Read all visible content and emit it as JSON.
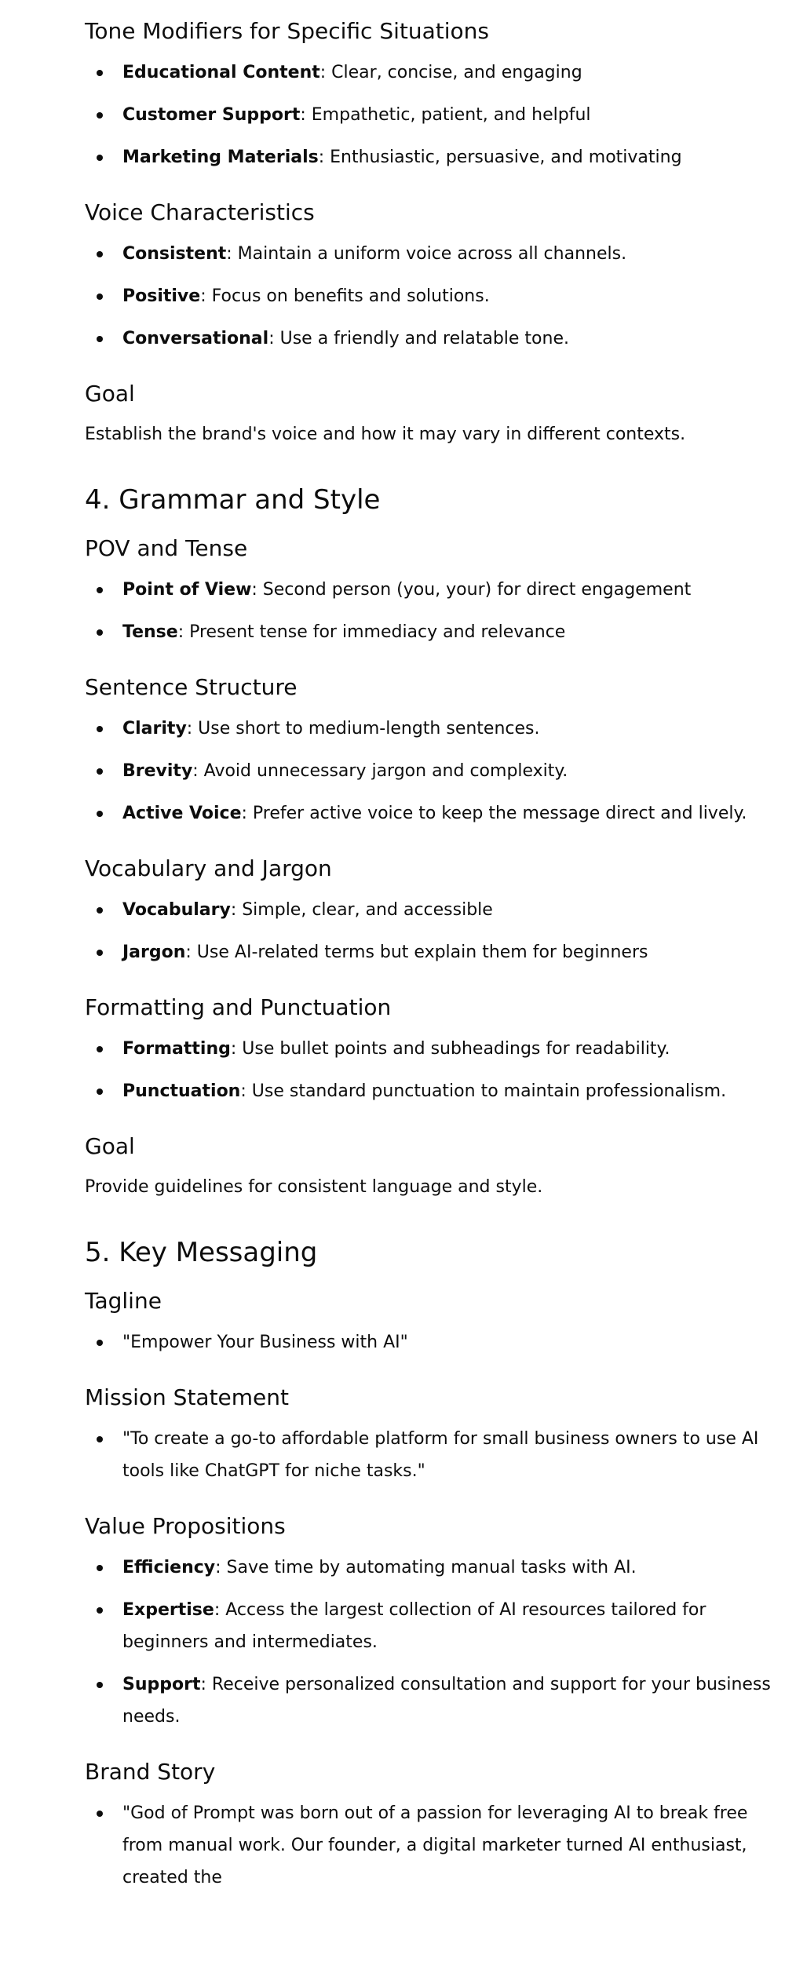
{
  "tone_modifiers": {
    "heading": "Tone Modifiers for Specific Situations",
    "items": [
      {
        "term": "Educational Content",
        "desc": ": Clear, concise, and engaging"
      },
      {
        "term": "Customer Support",
        "desc": ": Empathetic, patient, and helpful"
      },
      {
        "term": "Marketing Materials",
        "desc": ": Enthusiastic, persuasive, and motivating"
      }
    ]
  },
  "voice": {
    "heading": "Voice Characteristics",
    "items": [
      {
        "term": "Consistent",
        "desc": ": Maintain a uniform voice across all channels."
      },
      {
        "term": "Positive",
        "desc": ": Focus on benefits and solutions."
      },
      {
        "term": "Conversational",
        "desc": ": Use a friendly and relatable tone."
      }
    ]
  },
  "goal1": {
    "heading": "Goal",
    "text": "Establish the brand's voice and how it may vary in different contexts."
  },
  "section4": {
    "title": "4. Grammar and Style",
    "pov": {
      "heading": "POV and Tense",
      "items": [
        {
          "term": "Point of View",
          "desc": ": Second person (you, your) for direct engagement"
        },
        {
          "term": "Tense",
          "desc": ": Present tense for immediacy and relevance"
        }
      ]
    },
    "sentence": {
      "heading": "Sentence Structure",
      "items": [
        {
          "term": "Clarity",
          "desc": ": Use short to medium-length sentences."
        },
        {
          "term": "Brevity",
          "desc": ": Avoid unnecessary jargon and complexity."
        },
        {
          "term": "Active Voice",
          "desc": ": Prefer active voice to keep the message direct and lively."
        }
      ]
    },
    "vocab": {
      "heading": "Vocabulary and Jargon",
      "items": [
        {
          "term": "Vocabulary",
          "desc": ": Simple, clear, and accessible"
        },
        {
          "term": "Jargon",
          "desc": ": Use AI-related terms but explain them for beginners"
        }
      ]
    },
    "formatting": {
      "heading": "Formatting and Punctuation",
      "items": [
        {
          "term": "Formatting",
          "desc": ": Use bullet points and subheadings for readability."
        },
        {
          "term": "Punctuation",
          "desc": ": Use standard punctuation to maintain professionalism."
        }
      ]
    },
    "goal": {
      "heading": "Goal",
      "text": "Provide guidelines for consistent language and style."
    }
  },
  "section5": {
    "title": "5. Key Messaging",
    "tagline": {
      "heading": "Tagline",
      "text": "\"Empower Your Business with AI\""
    },
    "mission": {
      "heading": "Mission Statement",
      "text": "\"To create a go-to affordable platform for small business owners to use AI tools like ChatGPT for niche tasks.\""
    },
    "value": {
      "heading": "Value Propositions",
      "items": [
        {
          "term": "Efficiency",
          "desc": ": Save time by automating manual tasks with AI."
        },
        {
          "term": "Expertise",
          "desc": ": Access the largest collection of AI resources tailored for beginners and intermediates."
        },
        {
          "term": "Support",
          "desc": ": Receive personalized consultation and support for your business needs."
        }
      ]
    },
    "story": {
      "heading": "Brand Story",
      "text": "\"God of Prompt was born out of a passion for leveraging AI to break free from manual work. Our founder, a digital marketer turned AI enthusiast, created the"
    }
  }
}
